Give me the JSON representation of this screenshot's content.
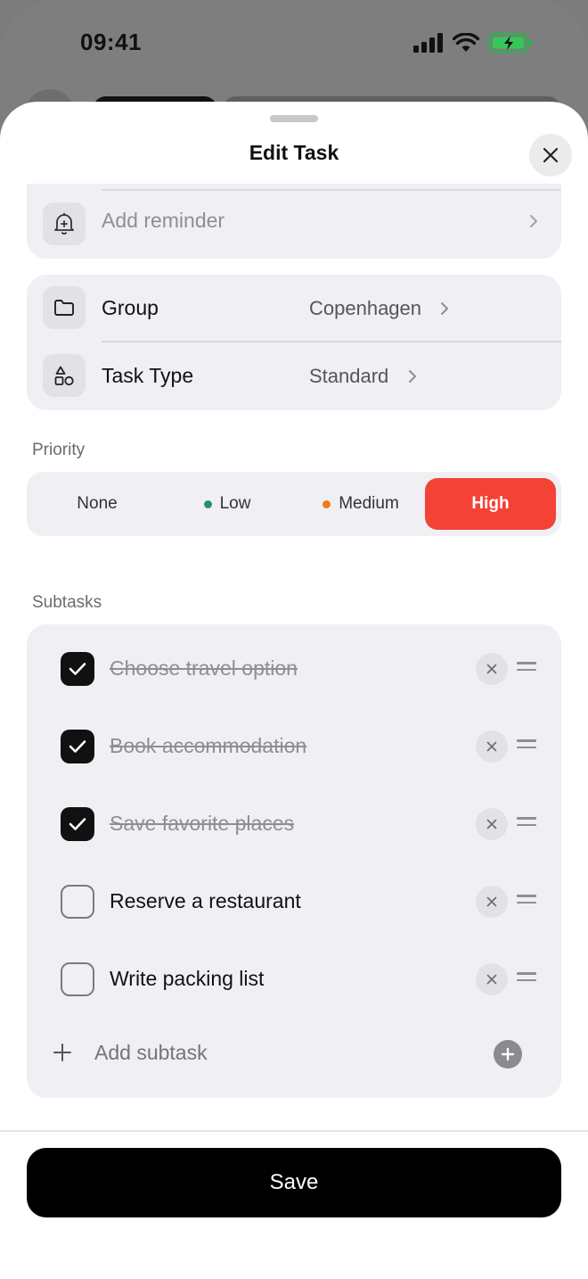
{
  "status_bar": {
    "time": "09:41",
    "icons": [
      "signal-icon",
      "wifi-icon",
      "battery-charging-icon"
    ],
    "battery_color": "#34c759"
  },
  "sheet": {
    "title": "Edit Task",
    "close_icon": "close-icon"
  },
  "reminder": {
    "icon": "bell-plus-icon",
    "label": "Add reminder"
  },
  "details": {
    "group": {
      "icon": "folder-icon",
      "label": "Group",
      "value": "Copenhagen"
    },
    "task_type": {
      "icon": "shapes-icon",
      "label": "Task Type",
      "value": "Standard"
    }
  },
  "priority": {
    "section_label": "Priority",
    "options": [
      {
        "label": "None",
        "dot_color": null,
        "selected": false
      },
      {
        "label": "Low",
        "dot_color": "#2f8a78",
        "selected": false
      },
      {
        "label": "Medium",
        "dot_color": "#f07a1a",
        "selected": false
      },
      {
        "label": "High",
        "dot_color": null,
        "selected": true
      }
    ],
    "selected_color": "#f44336"
  },
  "subtasks": {
    "section_label": "Subtasks",
    "items": [
      {
        "text": "Choose travel option",
        "done": true
      },
      {
        "text": "Book accommodation",
        "done": true
      },
      {
        "text": "Save favorite places",
        "done": true
      },
      {
        "text": "Reserve a restaurant",
        "done": false
      },
      {
        "text": "Write packing list",
        "done": false
      }
    ],
    "add_placeholder": "Add subtask"
  },
  "footer": {
    "save_label": "Save"
  }
}
